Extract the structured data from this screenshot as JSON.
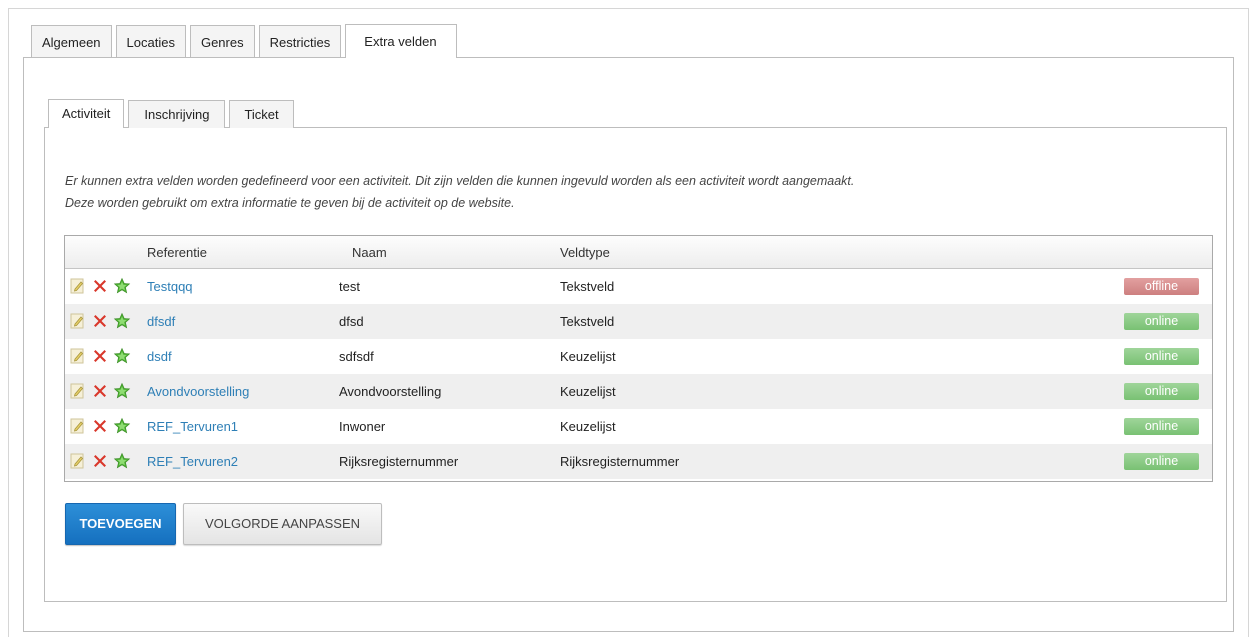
{
  "main_tabs": [
    {
      "label": "Algemeen",
      "active": false
    },
    {
      "label": "Locaties",
      "active": false
    },
    {
      "label": "Genres",
      "active": false
    },
    {
      "label": "Restricties",
      "active": false
    },
    {
      "label": "Extra velden",
      "active": true
    }
  ],
  "sub_tabs": [
    {
      "label": "Activiteit",
      "active": true
    },
    {
      "label": "Inschrijving",
      "active": false
    },
    {
      "label": "Ticket",
      "active": false
    }
  ],
  "description": {
    "line1": "Er kunnen extra velden worden gedefineerd voor een activiteit. Dit zijn velden die kunnen ingevuld worden als een activiteit wordt aangemaakt.",
    "line2": "Deze worden gebruikt om extra informatie te geven bij de activiteit op de website."
  },
  "table": {
    "headers": {
      "referentie": "Referentie",
      "naam": "Naam",
      "veldtype": "Veldtype"
    },
    "rows": [
      {
        "referentie": "Testqqq",
        "naam": "test",
        "veldtype": "Tekstveld",
        "status": "offline"
      },
      {
        "referentie": "dfsdf",
        "naam": "dfsd",
        "veldtype": "Tekstveld",
        "status": "online"
      },
      {
        "referentie": "dsdf",
        "naam": "sdfsdf",
        "veldtype": "Keuzelijst",
        "status": "online"
      },
      {
        "referentie": "Avondvoorstelling",
        "naam": "Avondvoorstelling",
        "veldtype": "Keuzelijst",
        "status": "online"
      },
      {
        "referentie": "REF_Tervuren1",
        "naam": "Inwoner",
        "veldtype": "Keuzelijst",
        "status": "online"
      },
      {
        "referentie": "REF_Tervuren2",
        "naam": "Rijksregisternummer",
        "veldtype": "Rijksregisternummer",
        "status": "online"
      }
    ],
    "row_icons": [
      "edit-icon",
      "delete-icon",
      "star-icon"
    ]
  },
  "buttons": {
    "add": "TOEVOEGEN",
    "reorder": "VOLGORDE AANPASSEN"
  },
  "colors": {
    "link": "#2e7fb6",
    "primary_button": "#1f7fcc",
    "online": "#85c77f",
    "offline": "#d68989",
    "delete": "#d9372b",
    "star": "#4caf32"
  }
}
